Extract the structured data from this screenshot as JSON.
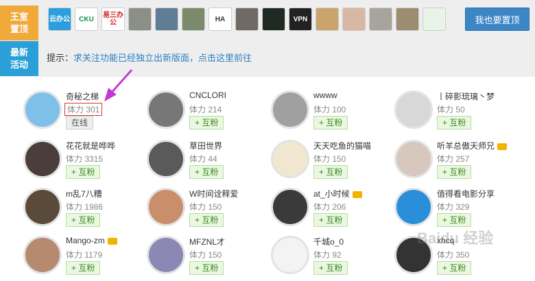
{
  "sidebar": {
    "royal_line1": "王室",
    "royal_line2": "置顶",
    "news_line1": "最新",
    "news_line2": "活动"
  },
  "logos": [
    {
      "text": "云办公",
      "bg": "#2b9fde",
      "fg": "#ffffff"
    },
    {
      "text": "CKU",
      "bg": "#ffffff",
      "fg": "#1a8f4a"
    },
    {
      "text": "易三办公",
      "bg": "#ffffff",
      "fg": "#d6242a"
    },
    {
      "text": "",
      "bg": "#8b8f87",
      "fg": "#ffffff"
    },
    {
      "text": "",
      "bg": "#5f7d95",
      "fg": "#ffffff"
    },
    {
      "text": "",
      "bg": "#7c8a6c",
      "fg": "#ffffff"
    },
    {
      "text": "HA",
      "bg": "#ffffff",
      "fg": "#333333"
    },
    {
      "text": "",
      "bg": "#6f6a64",
      "fg": "#ffffff"
    },
    {
      "text": "",
      "bg": "#1e2a22",
      "fg": "#ffffff"
    },
    {
      "text": "VPN",
      "bg": "#222222",
      "fg": "#ffffff"
    },
    {
      "text": "",
      "bg": "#c9a46b",
      "fg": "#ffffff"
    },
    {
      "text": "",
      "bg": "#d9b8a3",
      "fg": "#ffffff"
    },
    {
      "text": "",
      "bg": "#a7a49b",
      "fg": "#ffffff"
    },
    {
      "text": "",
      "bg": "#9c8c70",
      "fg": "#ffffff"
    },
    {
      "text": "",
      "bg": "#e8f4e8",
      "fg": "#2d8a3b"
    }
  ],
  "pin_button": "我也要置顶",
  "notice": {
    "prefix": "提示：",
    "link": "求关注功能已经独立出新版面，点击这里前往"
  },
  "users": [
    {
      "name": "奇秘之梯",
      "stamina": "体力 301",
      "button": "在线",
      "avatar_color": "#7fc0e8",
      "crown": false
    },
    {
      "name": "CNCLORI",
      "stamina": "体力 214",
      "button": "+ 互粉",
      "avatar_color": "#777777",
      "crown": false
    },
    {
      "name": "wwww",
      "stamina": "体力 100",
      "button": "+ 互粉",
      "avatar_color": "#a0a0a0",
      "crown": false
    },
    {
      "name": "丨碎影琉璃丶梦",
      "stamina": "体力 50",
      "button": "+ 互粉",
      "avatar_color": "#d8d8d8",
      "crown": false
    },
    {
      "name": "花花就是哗哗",
      "stamina": "体力 3315",
      "button": "+ 互粉",
      "avatar_color": "#4a3d3a",
      "crown": false
    },
    {
      "name": "草田世界",
      "stamina": "体力 44",
      "button": "+ 互粉",
      "avatar_color": "#5a5a5a",
      "crown": false
    },
    {
      "name": "天天吃鱼的猫喵",
      "stamina": "体力 150",
      "button": "+ 互粉",
      "avatar_color": "#f1e6d0",
      "crown": false
    },
    {
      "name": "听羊总傲天师兄",
      "stamina": "体力 257",
      "button": "+ 互粉",
      "avatar_color": "#d7c7bd",
      "crown": true
    },
    {
      "name": "m乱7八糟",
      "stamina": "体力 1986",
      "button": "+ 互粉",
      "avatar_color": "#5a4a3a",
      "crown": false
    },
    {
      "name": "W时间诠释爱",
      "stamina": "体力 150",
      "button": "+ 互粉",
      "avatar_color": "#c98f6a",
      "crown": false
    },
    {
      "name": "at_小时候",
      "stamina": "体力 206",
      "button": "+ 互粉",
      "avatar_color": "#3a3a3a",
      "crown": true
    },
    {
      "name": "值得看电影分享",
      "stamina": "体力 329",
      "button": "+ 互粉",
      "avatar_color": "#2a8fd8",
      "crown": false
    },
    {
      "name": "Mango-zm",
      "stamina": "体力 1179",
      "button": "+ 互粉",
      "avatar_color": "#b58a6f",
      "crown": true
    },
    {
      "name": "MFZNL才",
      "stamina": "体力 150",
      "button": "+ 互粉",
      "avatar_color": "#8c88b5",
      "crown": false
    },
    {
      "name": "千城o_0",
      "stamina": "体力 92",
      "button": "+ 互粉",
      "avatar_color": "#f3f3f3",
      "crown": false
    },
    {
      "name": "xhcq",
      "stamina": "体力 350",
      "button": "+ 互粉",
      "avatar_color": "#333333",
      "crown": false
    }
  ],
  "watermark": "Baidu 经验",
  "colors": {
    "royal_tab": "#f2a93b",
    "news_tab": "#2a9fd8",
    "pin_button": "#3d86c6",
    "follow_green": "#3b8a1f",
    "link_blue": "#2c7fc2",
    "highlight_box": "#dd3333",
    "arrow": "#c23ad6"
  }
}
